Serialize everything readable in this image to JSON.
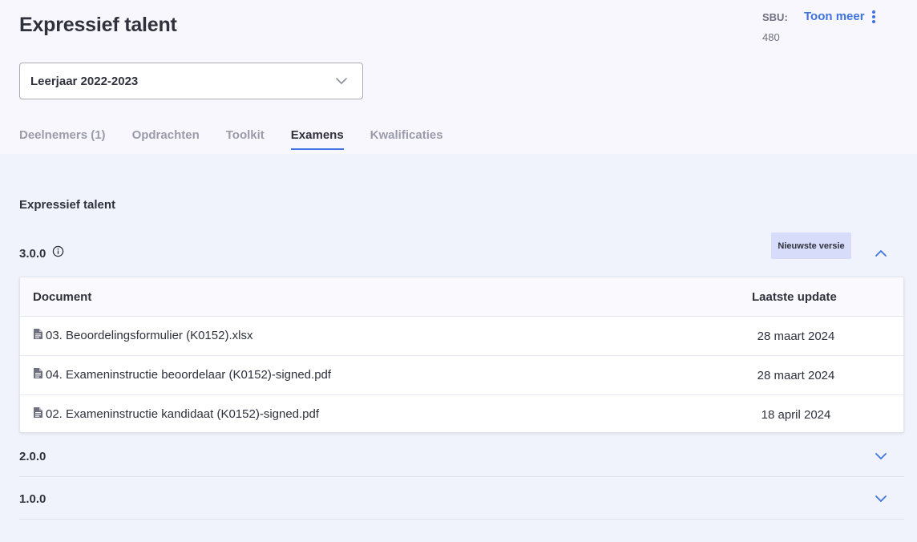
{
  "header": {
    "title": "Expressief talent",
    "sbu_label": "SBU:",
    "sbu_value": "480",
    "more_label": "Toon meer"
  },
  "year_select": {
    "value": "Leerjaar 2022-2023"
  },
  "tabs": [
    {
      "label": "Deelnemers (1)",
      "active": false
    },
    {
      "label": "Opdrachten",
      "active": false
    },
    {
      "label": "Toolkit",
      "active": false
    },
    {
      "label": "Examens",
      "active": true
    },
    {
      "label": "Kwalificaties",
      "active": false
    }
  ],
  "section": {
    "title": "Expressief talent"
  },
  "versions": {
    "current": {
      "label": "3.0.0",
      "badge": "Nieuwste versie",
      "table": {
        "col_document": "Document",
        "col_update": "Laatste update",
        "rows": [
          {
            "document": "03. Beoordelingsformulier (K0152).xlsx",
            "updated": "28 maart 2024"
          },
          {
            "document": "04. Exameninstructie beoordelaar (K0152)-signed.pdf",
            "updated": "28 maart 2024"
          },
          {
            "document": "02. Exameninstructie kandidaat (K0152)-signed.pdf",
            "updated": "18 april 2024"
          }
        ]
      }
    },
    "older": [
      {
        "label": "2.0.0"
      },
      {
        "label": "1.0.0"
      }
    ]
  },
  "colors": {
    "accent": "#3f73e0",
    "badge_bg": "#d6dcf9",
    "page_bg": "#f1f3fc",
    "header_bg": "#f7f7fd"
  },
  "icons": {
    "more": "vertical-dots-icon",
    "select": "chevron-down-icon",
    "info": "info-icon",
    "file": "file-icon",
    "expand": "chevron-up-icon",
    "collapse": "chevron-down-icon"
  }
}
